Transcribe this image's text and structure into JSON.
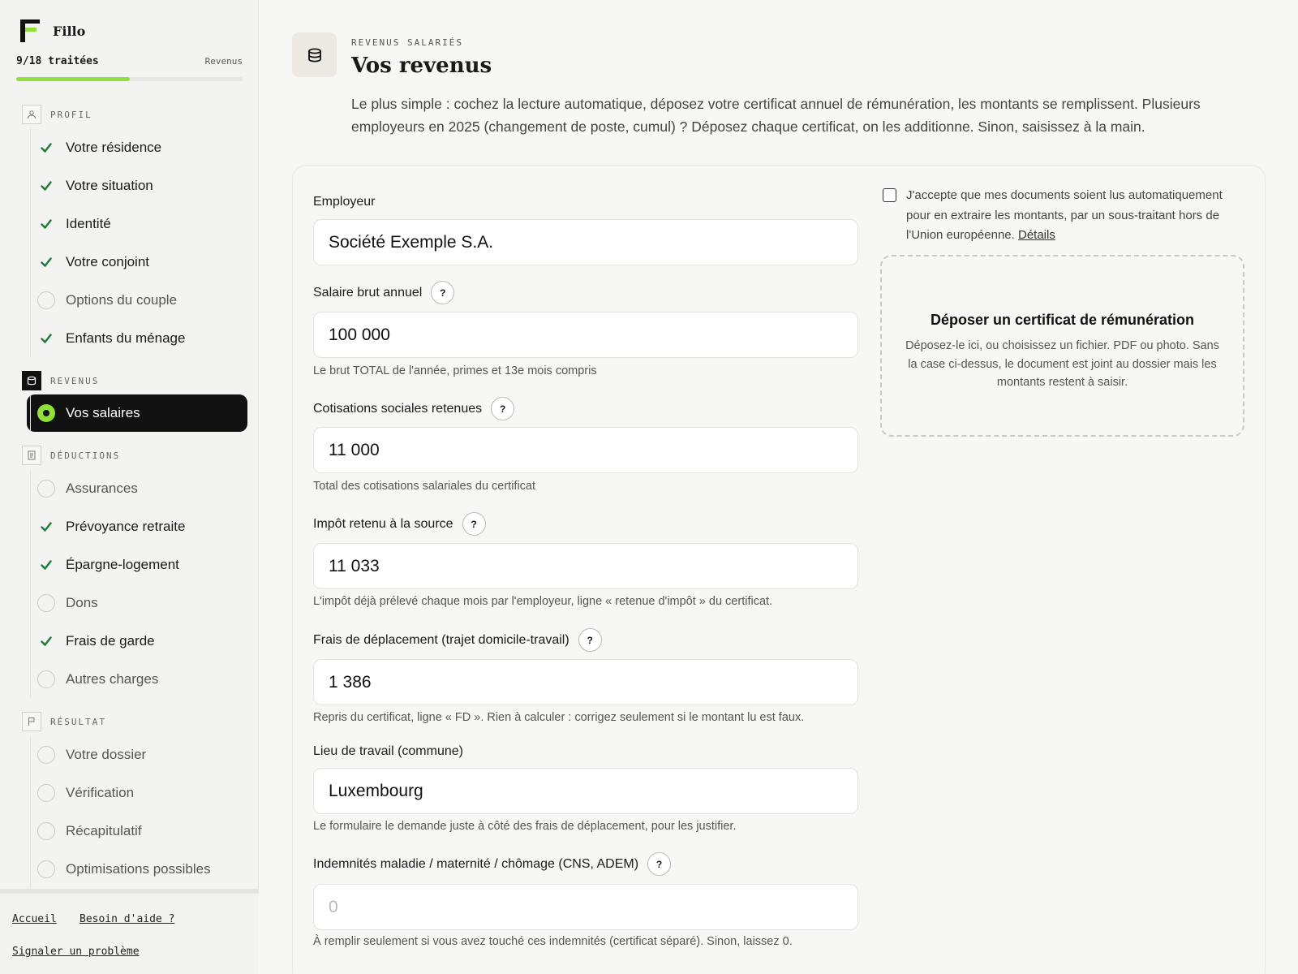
{
  "sidebar": {
    "brand": "Fillo",
    "progress": {
      "count": "9/18 traitées",
      "section": "Revenus",
      "fraction": 0.5
    },
    "sections": [
      {
        "label": "PROFIL",
        "icon": "person-icon",
        "items": [
          {
            "label": "Votre résidence",
            "state": "done"
          },
          {
            "label": "Votre situation",
            "state": "done"
          },
          {
            "label": "Identité",
            "state": "done"
          },
          {
            "label": "Votre conjoint",
            "state": "done"
          },
          {
            "label": "Options du couple",
            "state": "todo"
          },
          {
            "label": "Enfants du ménage",
            "state": "done"
          }
        ]
      },
      {
        "label": "REVENUS",
        "icon": "coins-icon",
        "items": [
          {
            "label": "Vos salaires",
            "state": "active"
          }
        ]
      },
      {
        "label": "DÉDUCTIONS",
        "icon": "receipt-icon",
        "items": [
          {
            "label": "Assurances",
            "state": "todo"
          },
          {
            "label": "Prévoyance retraite",
            "state": "done"
          },
          {
            "label": "Épargne-logement",
            "state": "done"
          },
          {
            "label": "Dons",
            "state": "todo"
          },
          {
            "label": "Frais de garde",
            "state": "done"
          },
          {
            "label": "Autres charges",
            "state": "todo"
          }
        ]
      },
      {
        "label": "RÉSULTAT",
        "icon": "flag-icon",
        "items": [
          {
            "label": "Votre dossier",
            "state": "todo"
          },
          {
            "label": "Vérification",
            "state": "todo"
          },
          {
            "label": "Récapitulatif",
            "state": "todo"
          },
          {
            "label": "Optimisations possibles",
            "state": "todo"
          }
        ]
      }
    ],
    "footer": {
      "home": "Accueil",
      "help": "Besoin d'aide ?",
      "report": "Signaler un problème"
    }
  },
  "header": {
    "eyebrow": "REVENUS SALARIÉS",
    "title": "Vos revenus",
    "intro": "Le plus simple : cochez la lecture automatique, déposez votre certificat annuel de rémunération, les montants se remplissent. Plusieurs employeurs en 2025 (changement de poste, cumul) ? Déposez chaque certificat, on les additionne. Sinon, saisissez à la main."
  },
  "form": {
    "employer": {
      "label": "Employeur",
      "value": "Société Exemple S.A."
    },
    "salary": {
      "label": "Salaire brut annuel",
      "value": "100 000",
      "hint": "Le brut TOTAL de l'année, primes et 13e mois compris"
    },
    "social": {
      "label": "Cotisations sociales retenues",
      "value": "11 000",
      "hint": "Total des cotisations salariales du certificat"
    },
    "tax": {
      "label": "Impôt retenu à la source",
      "value": "11 033",
      "hint": "L'impôt déjà prélevé chaque mois par l'employeur, ligne « retenue d'impôt » du certificat."
    },
    "travel": {
      "label": "Frais de déplacement (trajet domicile-travail)",
      "value": "1 386",
      "hint": "Repris du certificat, ligne « FD ». Rien à calculer : corrigez seulement si le montant lu est faux."
    },
    "workplace": {
      "label": "Lieu de travail (commune)",
      "value": "Luxembourg",
      "hint": "Le formulaire le demande juste à côté des frais de déplacement, pour les justifier."
    },
    "benefits": {
      "label": "Indemnités maladie / maternité / chômage (CNS, ADEM)",
      "value": "",
      "placeholder": "0",
      "hint": "À remplir seulement si vous avez touché ces indemnités (certificat séparé). Sinon, laissez 0."
    },
    "help_glyph": "?"
  },
  "upload": {
    "consent": "J'accepte que mes documents soient lus automatiquement pour en extraire les montants, par un sous-traitant hors de l'Union européenne.",
    "details_link": "Détails",
    "title": "Déposer un certificat de rémunération",
    "text": "Déposez-le ici, ou choisissez un fichier. PDF ou photo. Sans la case ci-dessus, le document est joint au dossier mais les montants restent à saisir."
  },
  "colors": {
    "accent": "#8fe03a",
    "done": "#1f7a3a",
    "active_bg": "#111111"
  }
}
